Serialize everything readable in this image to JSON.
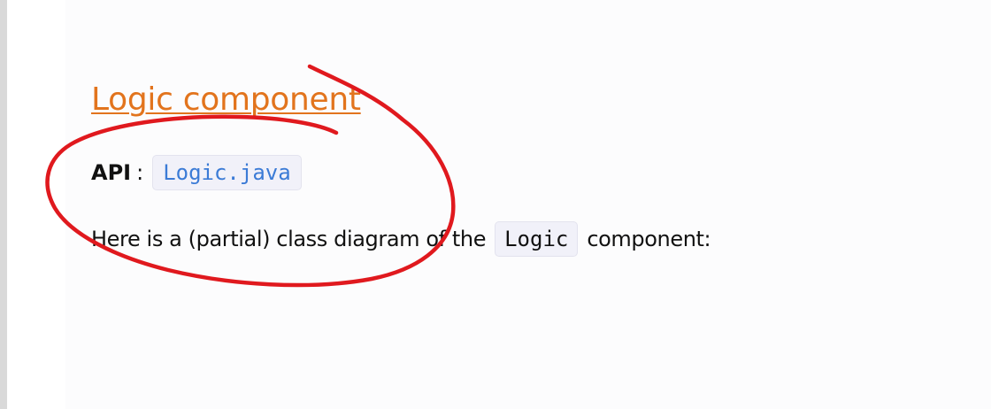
{
  "heading": {
    "text": "Logic component"
  },
  "api": {
    "label": "API",
    "separator": ":",
    "file_link": "Logic.java"
  },
  "description": {
    "before": "Here is a (partial) class diagram of the",
    "code": "Logic",
    "after": "component:"
  },
  "annotation": {
    "color": "#e0191e"
  },
  "colors": {
    "heading": "#e2741d",
    "link_code": "#3b7bd6",
    "code_background": "#f1f1f9",
    "text": "#111111"
  }
}
